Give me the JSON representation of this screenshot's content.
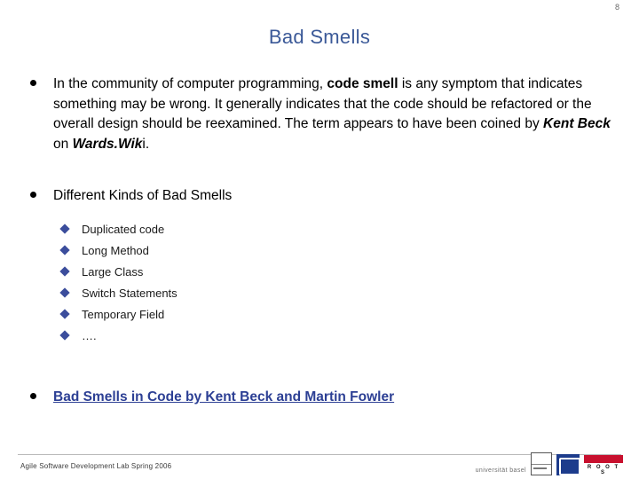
{
  "slide": {
    "page_number": "8",
    "title": "Bad Smells",
    "definition": {
      "text_part_1": "In the community of computer programming, ",
      "bold_1": "code smell",
      "text_part_2": " is  any symptom that indicates something may be wrong. It generally indicates that the code should be refactored or the overall design should be reexamined. The term appears to have been coined by  ",
      "bold_italic_1": "Kent Beck",
      "text_part_3": " on ",
      "bold_italic_2": "Wards.Wik",
      "text_part_4": "i."
    },
    "kinds_heading": "Different Kinds of Bad Smells",
    "kinds": [
      "Duplicated code",
      "Long Method",
      "Large Class",
      "Switch Statements",
      "Temporary Field",
      "…."
    ],
    "reference_link": "Bad Smells in Code by Kent Beck and Martin Fowler"
  },
  "footer": {
    "text": "Agile Software Development Lab Spring 2006",
    "university_text": "universität basel",
    "roots_text": "R O O T S"
  },
  "colors": {
    "title": "#3b5998",
    "link": "#2c3f94",
    "sub_bullet": "#3b4d9c"
  }
}
